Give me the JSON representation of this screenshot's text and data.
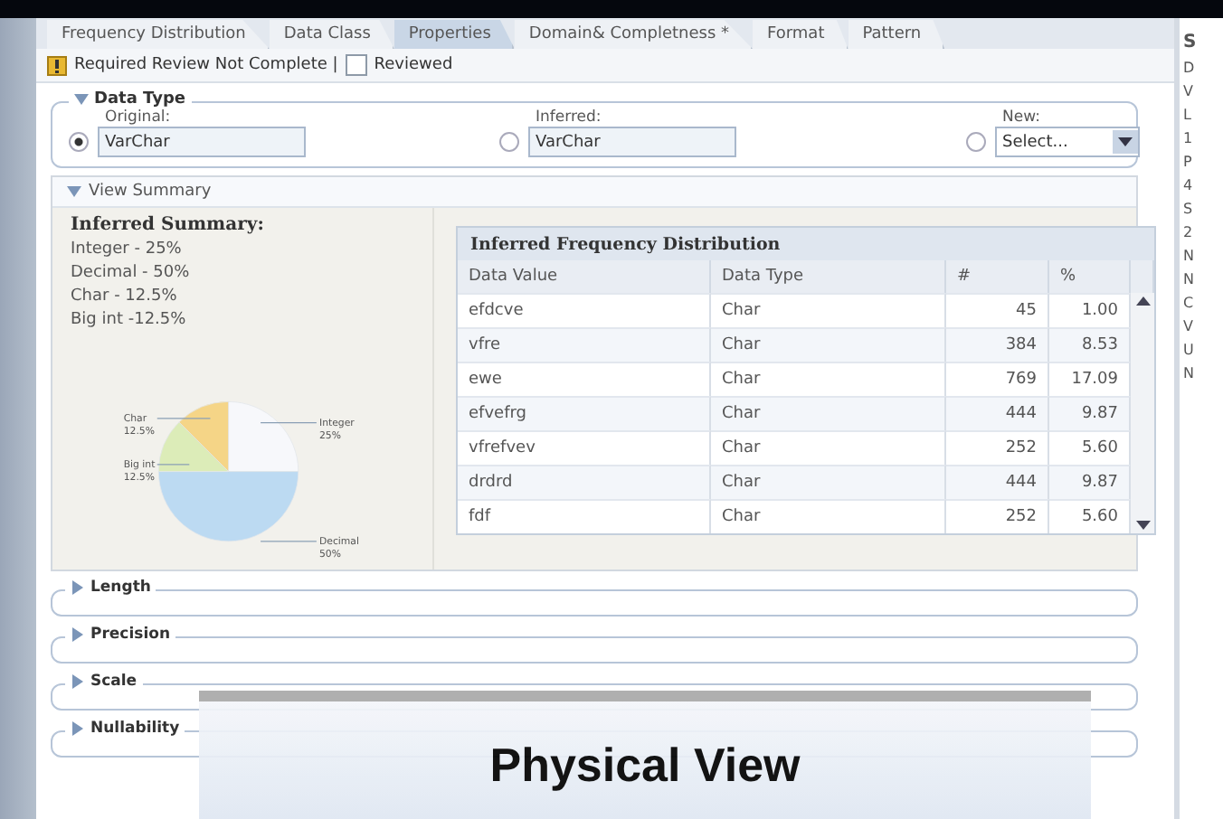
{
  "tabs": [
    {
      "label": "Frequency Distribution",
      "selected": false
    },
    {
      "label": "Data Class",
      "selected": false
    },
    {
      "label": "Properties",
      "selected": true
    },
    {
      "label": "Domain& Completness *",
      "selected": false
    },
    {
      "label": "Format",
      "selected": false
    },
    {
      "label": "Pattern",
      "selected": false
    }
  ],
  "review": {
    "warning": "Required Review Not Complete |",
    "checkbox_label": "Reviewed",
    "checked": false
  },
  "data_type": {
    "title": "Data Type",
    "expanded": true,
    "options": [
      {
        "label": "Original:",
        "value": "VarChar",
        "selected": true,
        "kind": "text"
      },
      {
        "label": "Inferred:",
        "value": "VarChar",
        "selected": false,
        "kind": "text"
      },
      {
        "label": "New:",
        "placeholder": "Select...",
        "selected": false,
        "kind": "select"
      }
    ]
  },
  "view_summary": {
    "title": "View Summary",
    "expanded": true,
    "summary_title": "Inferred Summary:",
    "summary_lines": [
      "Integer - 25%",
      "Decimal - 50%",
      "Char - 12.5%",
      "Big int -12.5%"
    ],
    "chart_data": {
      "type": "pie",
      "categories": [
        "Integer",
        "Decimal",
        "Big int",
        "Char"
      ],
      "values": [
        25,
        50,
        12.5,
        12.5
      ],
      "colors": [
        "#f7f8fb",
        "#bcdaf2",
        "#dcecb8",
        "#f5d587"
      ],
      "value_labels": [
        "25%",
        "50%",
        "12.5%",
        "12.5%"
      ]
    },
    "table": {
      "title": "Inferred Frequency Distribution",
      "columns": [
        "Data Value",
        "Data Type",
        "#",
        "%"
      ],
      "rows": [
        [
          "efdcve",
          "Char",
          "45",
          "1.00"
        ],
        [
          "vfre",
          "Char",
          "384",
          "8.53"
        ],
        [
          "ewe",
          "Char",
          "769",
          "17.09"
        ],
        [
          "efvefrg",
          "Char",
          "444",
          "9.87"
        ],
        [
          "vfrefvev",
          "Char",
          "252",
          "5.60"
        ],
        [
          "drdrd",
          "Char",
          "444",
          "9.87"
        ],
        [
          "fdf",
          "Char",
          "252",
          "5.60"
        ]
      ]
    }
  },
  "sections": [
    {
      "title": "Length",
      "expanded": false
    },
    {
      "title": "Precision",
      "expanded": false
    },
    {
      "title": "Scale",
      "expanded": false
    },
    {
      "title": "Nullability",
      "expanded": false
    }
  ],
  "side_panel": [
    "S",
    "D",
    "V",
    "L",
    "1",
    "P",
    "4",
    "S",
    "2",
    "N",
    "N",
    "C",
    "V",
    "U",
    "N"
  ],
  "caption": "Physical View"
}
